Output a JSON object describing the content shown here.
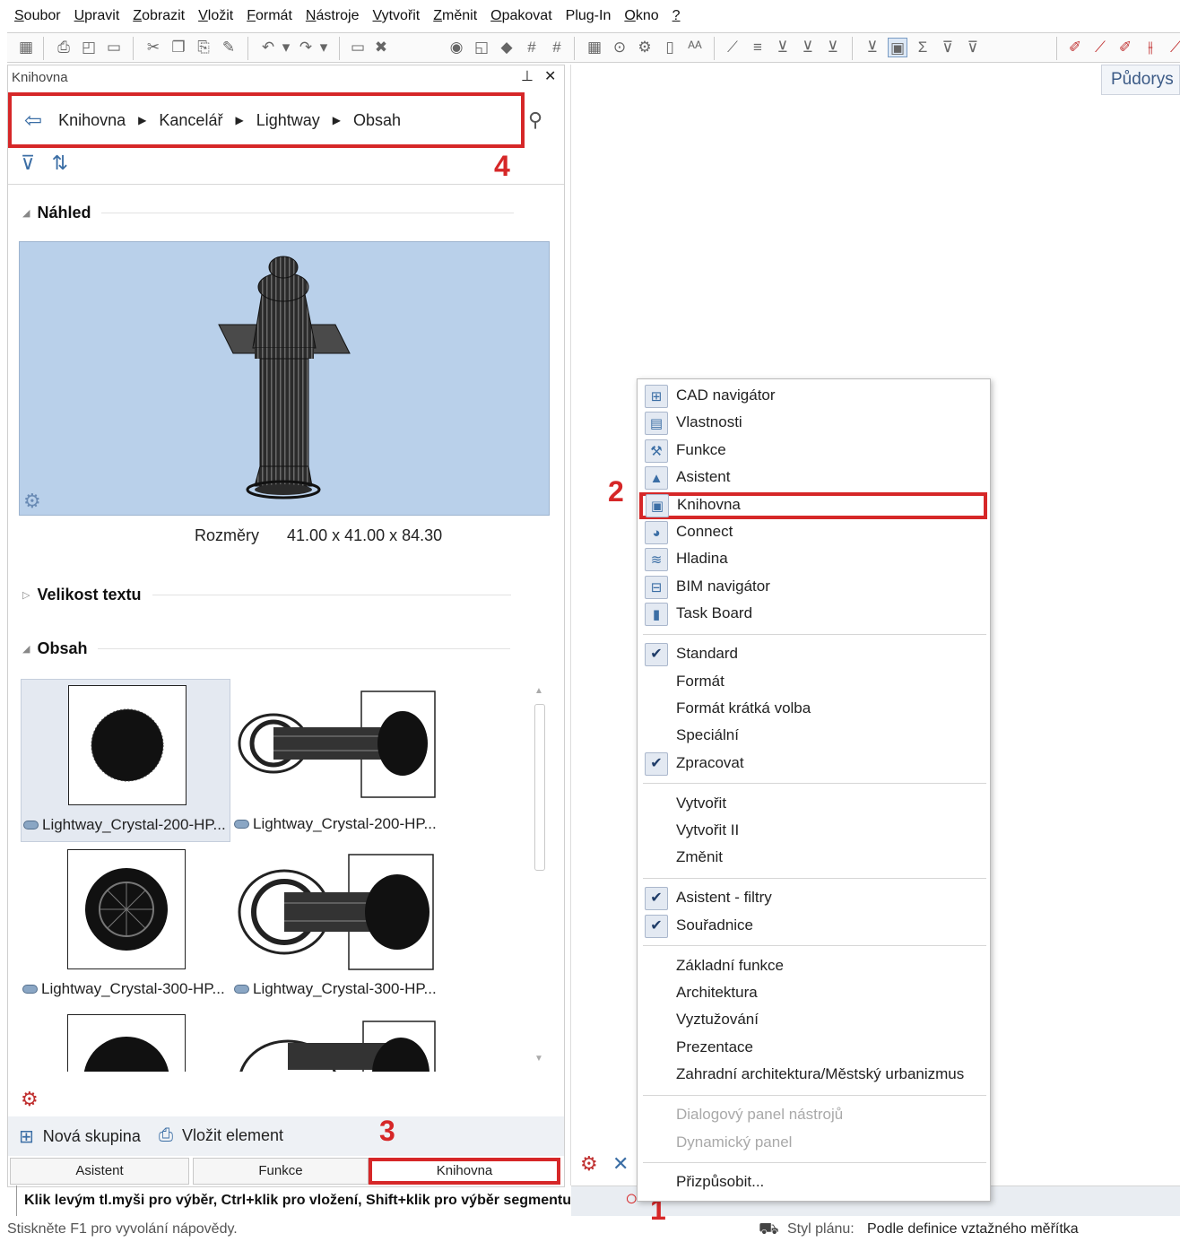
{
  "menubar": {
    "items": [
      {
        "mnemonic": "S",
        "rest": "oubor"
      },
      {
        "mnemonic": "U",
        "rest": "pravit"
      },
      {
        "mnemonic": "Z",
        "rest": "obrazit"
      },
      {
        "mnemonic": "V",
        "rest": "ložit"
      },
      {
        "mnemonic": "F",
        "rest": "ormát"
      },
      {
        "mnemonic": "N",
        "rest": "ástroje"
      },
      {
        "mnemonic": "V",
        "rest": "ytvořit"
      },
      {
        "mnemonic": "Z",
        "rest": "měnit"
      },
      {
        "mnemonic": "O",
        "rest": "pakovat"
      },
      {
        "mnemonic": "",
        "rest": "Plug-In"
      },
      {
        "mnemonic": "O",
        "rest": "kno"
      },
      {
        "mnemonic": "?",
        "rest": ""
      }
    ]
  },
  "panel": {
    "title": "Knihovna",
    "pin_icon": "pin-icon",
    "close_icon": "close-icon",
    "breadcrumb": [
      "Knihovna",
      "Kancelář",
      "Lightway",
      "Obsah"
    ],
    "annotation_breadcrumb": "4",
    "sections": {
      "preview": "Náhled",
      "text_size": "Velikost textu",
      "content": "Obsah"
    },
    "dimensions_label": "Rozměry",
    "dimensions_value": "41.00 x 41.00 x 84.30",
    "items": [
      {
        "label": "Lightway_Crystal-200-HP...",
        "view": "top",
        "selected": true
      },
      {
        "label": "Lightway_Crystal-200-HP...",
        "view": "side",
        "selected": false
      },
      {
        "label": "Lightway_Crystal-300-HP...",
        "view": "top",
        "selected": false
      },
      {
        "label": "Lightway_Crystal-300-HP...",
        "view": "side",
        "selected": false
      },
      {
        "label": "",
        "view": "top",
        "selected": false
      },
      {
        "label": "",
        "view": "side",
        "selected": false
      }
    ],
    "actions": {
      "new_group": "Nová skupina",
      "insert_element": "Vložit element"
    },
    "annotation_tab": "3",
    "tabs": [
      "Asistent",
      "Funkce",
      "Knihovna"
    ]
  },
  "view": {
    "tab_label": "Půdorys"
  },
  "context_menu": {
    "annotation": "2",
    "palettes": [
      {
        "label": "CAD navigátor",
        "icon": "cad-navigator-icon",
        "glyph": "⊞"
      },
      {
        "label": "Vlastnosti",
        "icon": "properties-icon",
        "glyph": "▤"
      },
      {
        "label": "Funkce",
        "icon": "functions-icon",
        "glyph": "⚒"
      },
      {
        "label": "Asistent",
        "icon": "wizard-icon",
        "glyph": "▲"
      },
      {
        "label": "Knihovna",
        "icon": "library-icon",
        "glyph": "▣"
      },
      {
        "label": "Connect",
        "icon": "connect-icon",
        "glyph": "◕"
      },
      {
        "label": "Hladina",
        "icon": "layer-icon",
        "glyph": "≋"
      },
      {
        "label": "BIM navigátor",
        "icon": "bim-navigator-icon",
        "glyph": "⊟"
      },
      {
        "label": "Task Board",
        "icon": "task-board-icon",
        "glyph": "▮"
      }
    ],
    "toolbars1": [
      {
        "label": "Standard",
        "checked": true
      },
      {
        "label": "Formát",
        "checked": false
      },
      {
        "label": "Formát krátká volba",
        "checked": false
      },
      {
        "label": "Speciální",
        "checked": false
      },
      {
        "label": "Zpracovat",
        "checked": true
      }
    ],
    "toolbars2": [
      {
        "label": "Vytvořit"
      },
      {
        "label": "Vytvořit II"
      },
      {
        "label": "Změnit"
      }
    ],
    "toolbars3": [
      {
        "label": "Asistent - filtry",
        "checked": true
      },
      {
        "label": "Souřadnice",
        "checked": true
      }
    ],
    "modules": [
      {
        "label": "Základní funkce"
      },
      {
        "label": "Architektura"
      },
      {
        "label": "Vyztužování"
      },
      {
        "label": "Prezentace"
      },
      {
        "label": "Zahradní architektura/Městský urbanizmus"
      }
    ],
    "disabled": [
      {
        "label": "Dialogový panel nástrojů"
      },
      {
        "label": "Dynamický panel"
      }
    ],
    "customize": "Přizpůsobit..."
  },
  "hint": "Klik levým tl.myši pro výběr, Ctrl+klik pro vložení, Shift+klik pro výběr segmentu",
  "annotation_status": "1",
  "status": {
    "help": "Stiskněte F1 pro vyvolání nápovědy.",
    "plan_style_label": "Styl plánu:",
    "plan_style_value": "Podle definice vztažného měřítka"
  }
}
